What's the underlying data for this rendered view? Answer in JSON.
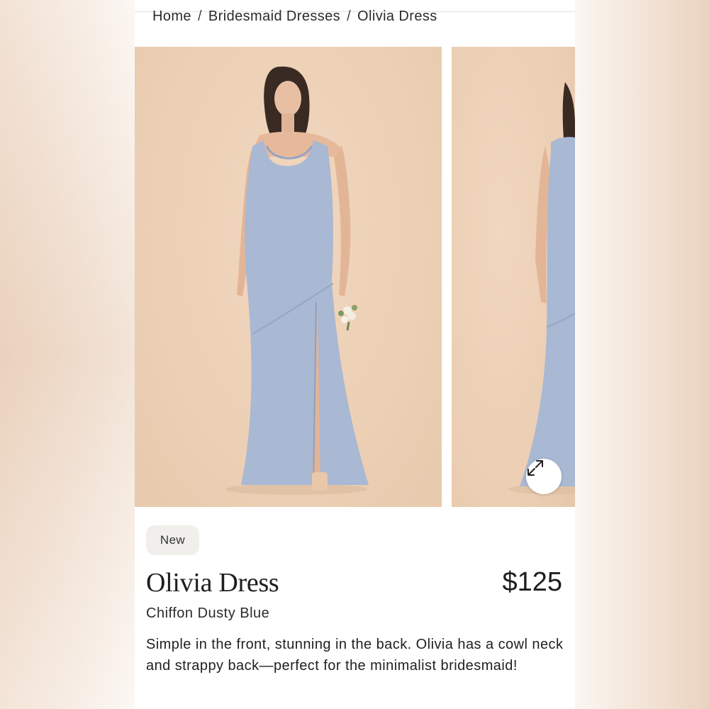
{
  "breadcrumb": {
    "items": [
      "Home",
      "Bridesmaid Dresses",
      "Olivia Dress"
    ],
    "separator": "/"
  },
  "gallery": {
    "expand_icon": "expand-arrows-icon",
    "dress_color": "#a9b8d3",
    "backdrop_color": "#edd2b8"
  },
  "product": {
    "badge": "New",
    "name": "Olivia Dress",
    "price": "$125",
    "variant": "Chiffon Dusty Blue",
    "description": "Simple in the front, stunning in the back. Olivia has a cowl neck and strappy back—perfect for the minimalist bridesmaid!"
  }
}
